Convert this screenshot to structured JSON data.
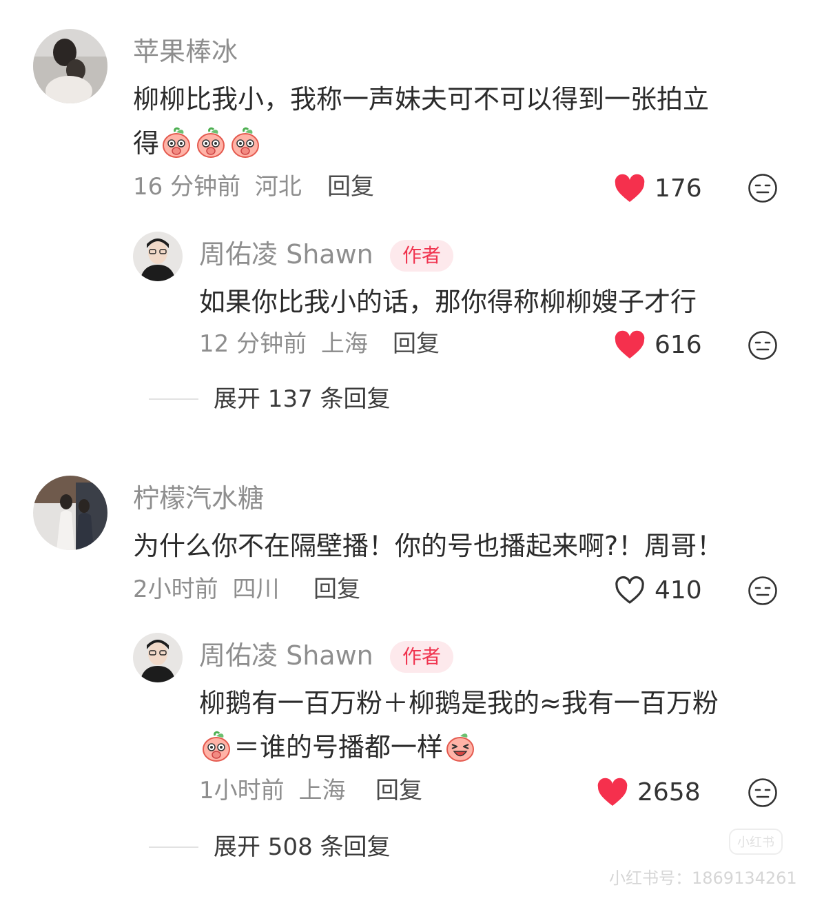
{
  "comments": [
    {
      "username": "苹果棒冰",
      "content_line1": "柳柳比我小，我称一声妹夫可不可以得到一张拍立",
      "content_line2": "得",
      "emojis": [
        "peach-blush-emoji",
        "peach-blush-emoji",
        "peach-blush-emoji"
      ],
      "time": "16 分钟前",
      "location": "河北",
      "reply_label": "回复",
      "likes": "176",
      "liked": true,
      "reply": {
        "username": "周佑凌 Shawn",
        "badge": "作者",
        "content": "如果你比我小的话，那你得称柳柳嫂子才行",
        "time": "12 分钟前",
        "location": "上海",
        "reply_label": "回复",
        "likes": "616",
        "liked": true
      },
      "expand_label": "展开 137 条回复"
    },
    {
      "username": "柠檬汽水糖",
      "content": "为什么你不在隔壁播！你的号也播起来啊?！周哥！",
      "time": "2小时前",
      "location": "四川",
      "reply_label": "回复",
      "likes": "410",
      "liked": false,
      "reply": {
        "username": "周佑凌 Shawn",
        "badge": "作者",
        "content_line1": "柳鹅有一百万粉＋柳鹅是我的≈我有一百万粉",
        "content_line2": "＝谁的号播都一样",
        "emojis": [
          "peach-blush-emoji",
          "peach-laugh-emoji"
        ],
        "time": "1小时前",
        "location": "上海",
        "reply_label": "回复",
        "likes": "2658",
        "liked": true
      },
      "expand_label": "展开 508 条回复"
    }
  ],
  "watermark": "小红书号：1869134261",
  "colors": {
    "like_red": "#f5304d",
    "badge_bg": "#fde9ec",
    "badge_text": "#f0344f",
    "muted": "#8e8e8e"
  }
}
